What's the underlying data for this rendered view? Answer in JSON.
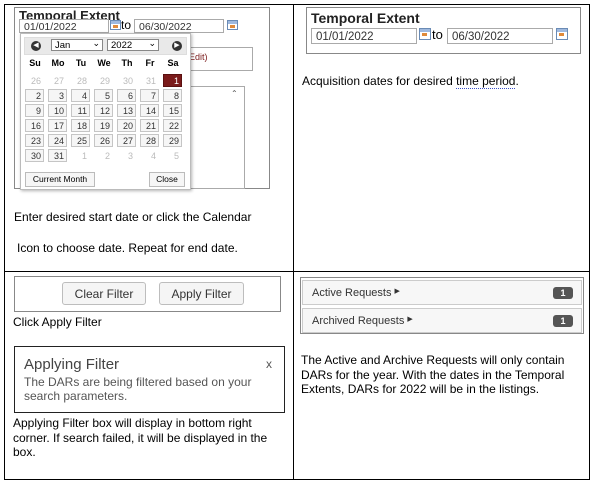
{
  "temporal_extent": {
    "title": "Temporal Extent",
    "start_value": "01/01/2022",
    "to_label": "to",
    "end_value": "06/30/2022"
  },
  "calendar": {
    "month": "Jan",
    "year": "2022",
    "weekdays": [
      "Su",
      "Mo",
      "Tu",
      "We",
      "Th",
      "Fr",
      "Sa"
    ],
    "weeks": [
      [
        "26",
        "27",
        "28",
        "29",
        "30",
        "31",
        "1"
      ],
      [
        "2",
        "3",
        "4",
        "5",
        "6",
        "7",
        "8"
      ],
      [
        "9",
        "10",
        "11",
        "12",
        "13",
        "14",
        "15"
      ],
      [
        "16",
        "17",
        "18",
        "19",
        "20",
        "21",
        "22"
      ],
      [
        "23",
        "24",
        "25",
        "26",
        "27",
        "28",
        "29"
      ],
      [
        "30",
        "31",
        "1",
        "2",
        "3",
        "4",
        "5"
      ]
    ],
    "current_month_label": "Current Month",
    "close_label": "Close",
    "behind_text": "Edit)"
  },
  "cell1": {
    "line1": "Enter desired start date or click the Calendar",
    "line2": "Icon to choose date.  Repeat for end date."
  },
  "cell2": {
    "text_before": "Acquisition dates for desired ",
    "text_dotted": "time period",
    "text_after": "."
  },
  "cell3": {
    "clear_filter": "Clear Filter",
    "apply_filter": "Apply Filter",
    "caption": "Click Apply Filter",
    "toast_title": "Applying Filter",
    "toast_close": "x",
    "toast_body": "The DARs are being filtered based on your search parameters.",
    "description": "Applying Filter box will display in bottom right corner.  If search failed, it will be displayed in the box."
  },
  "cell4": {
    "active_label": "Active Requests",
    "active_count": "1",
    "archived_label": "Archived Requests",
    "archived_count": "1",
    "description": "The Active and Archive Requests will only contain DARs for the year. With the dates in the Temporal Extents, DARs for 2022 will be in the listings."
  }
}
